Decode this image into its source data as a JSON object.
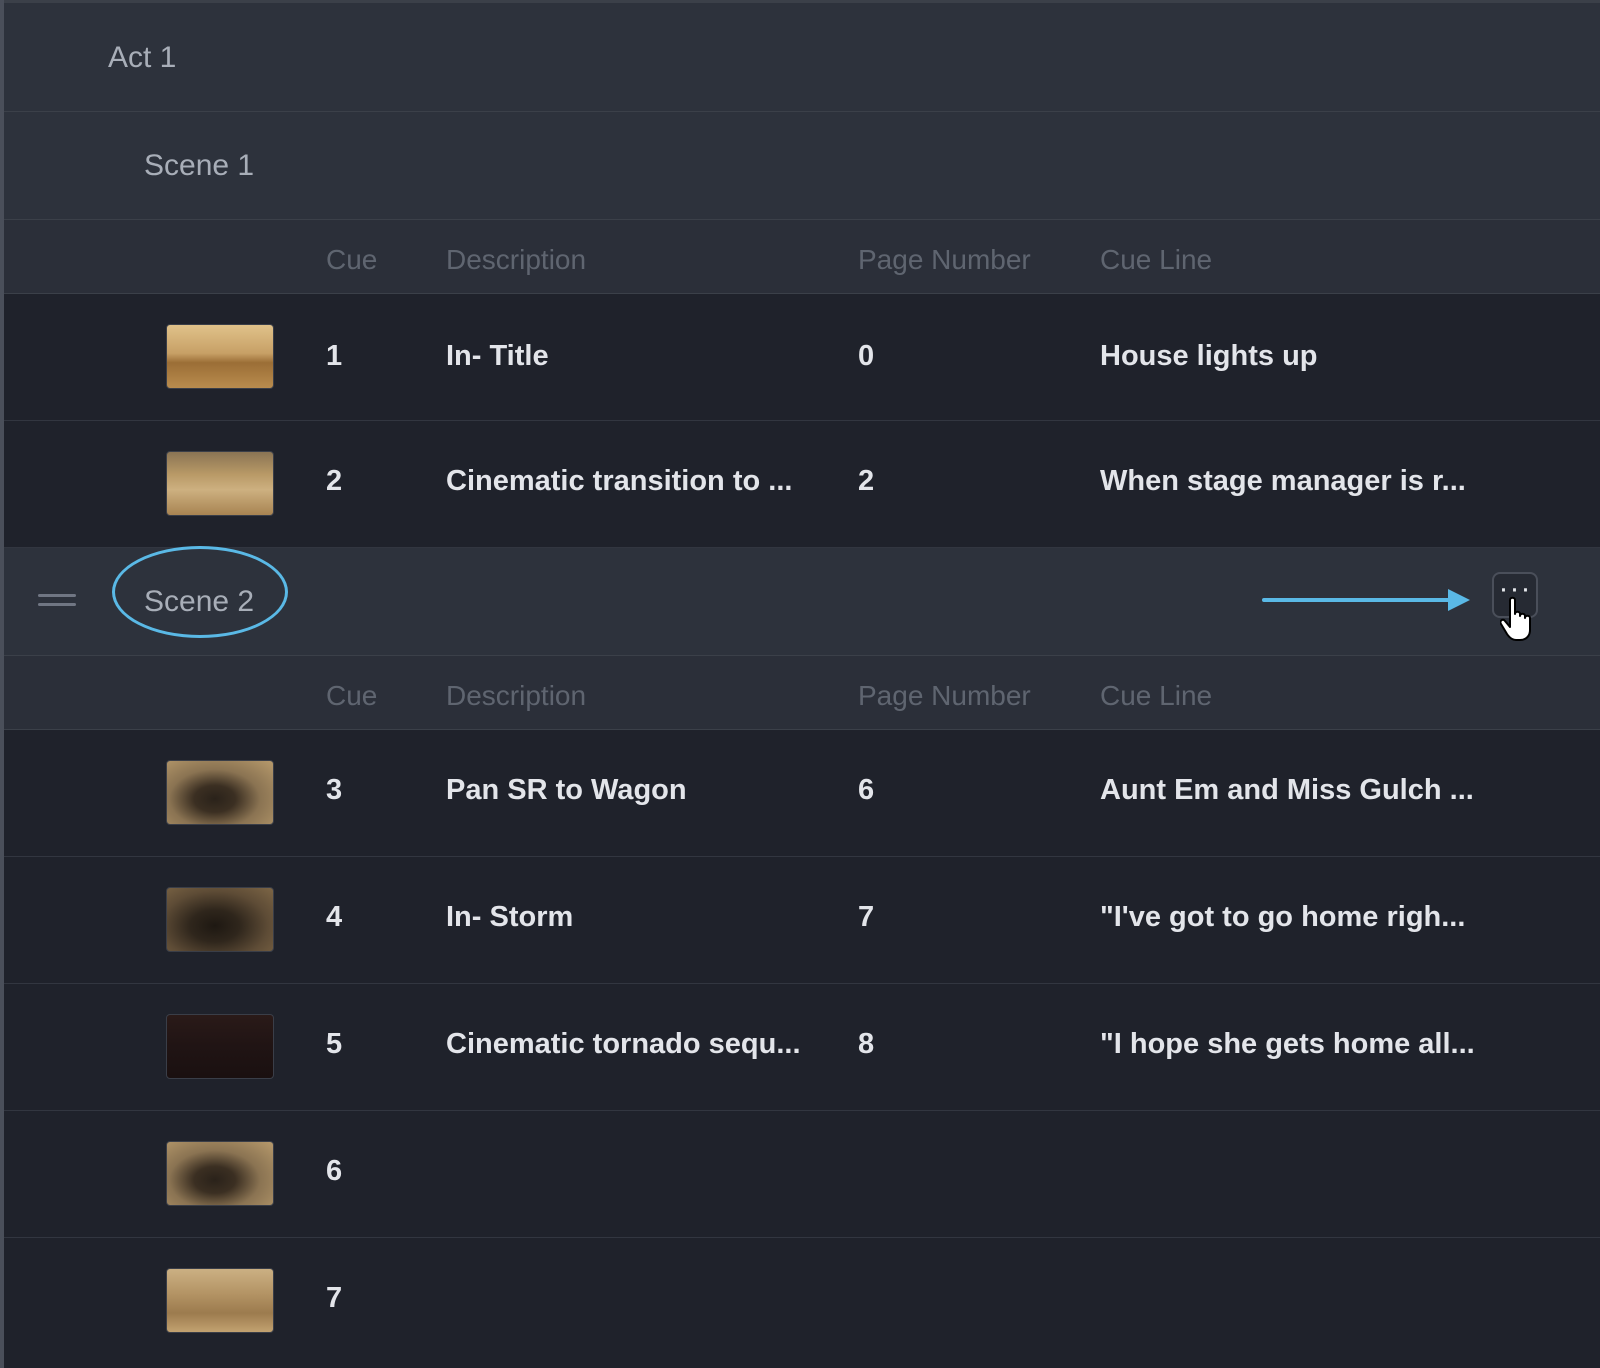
{
  "act": {
    "label": "Act 1"
  },
  "columns": {
    "cue": "Cue",
    "description": "Description",
    "page": "Page Number",
    "cue_line": "Cue Line"
  },
  "scenes": [
    {
      "label": "Scene 1",
      "rows": [
        {
          "cue": "1",
          "description": "In- Title",
          "page": "0",
          "cue_line": "House lights up",
          "thumb": "desert-landscape"
        },
        {
          "cue": "2",
          "description": "Cinematic transition to ...",
          "page": "2",
          "cue_line": "When stage manager is r...",
          "thumb": "farm-town"
        }
      ]
    },
    {
      "label": "Scene 2",
      "rows": [
        {
          "cue": "3",
          "description": "Pan SR to Wagon",
          "page": "6",
          "cue_line": "Aunt Em and Miss Gulch ...",
          "thumb": "wagon"
        },
        {
          "cue": "4",
          "description": "In- Storm",
          "page": "7",
          "cue_line": "\"I've got to go home righ...",
          "thumb": "wagon-storm"
        },
        {
          "cue": "5",
          "description": "Cinematic tornado sequ...",
          "page": "8",
          "cue_line": "\"I hope she gets home all...",
          "thumb": "dark"
        },
        {
          "cue": "6",
          "description": "",
          "page": "",
          "cue_line": "",
          "thumb": "wagon"
        },
        {
          "cue": "7",
          "description": "",
          "page": "",
          "cue_line": "",
          "thumb": "bare-tree"
        }
      ]
    }
  ],
  "more_button": {
    "label": "···"
  },
  "colors": {
    "accent": "#5ab9e6",
    "background": "#1c1f27",
    "band": "#2d323c"
  }
}
